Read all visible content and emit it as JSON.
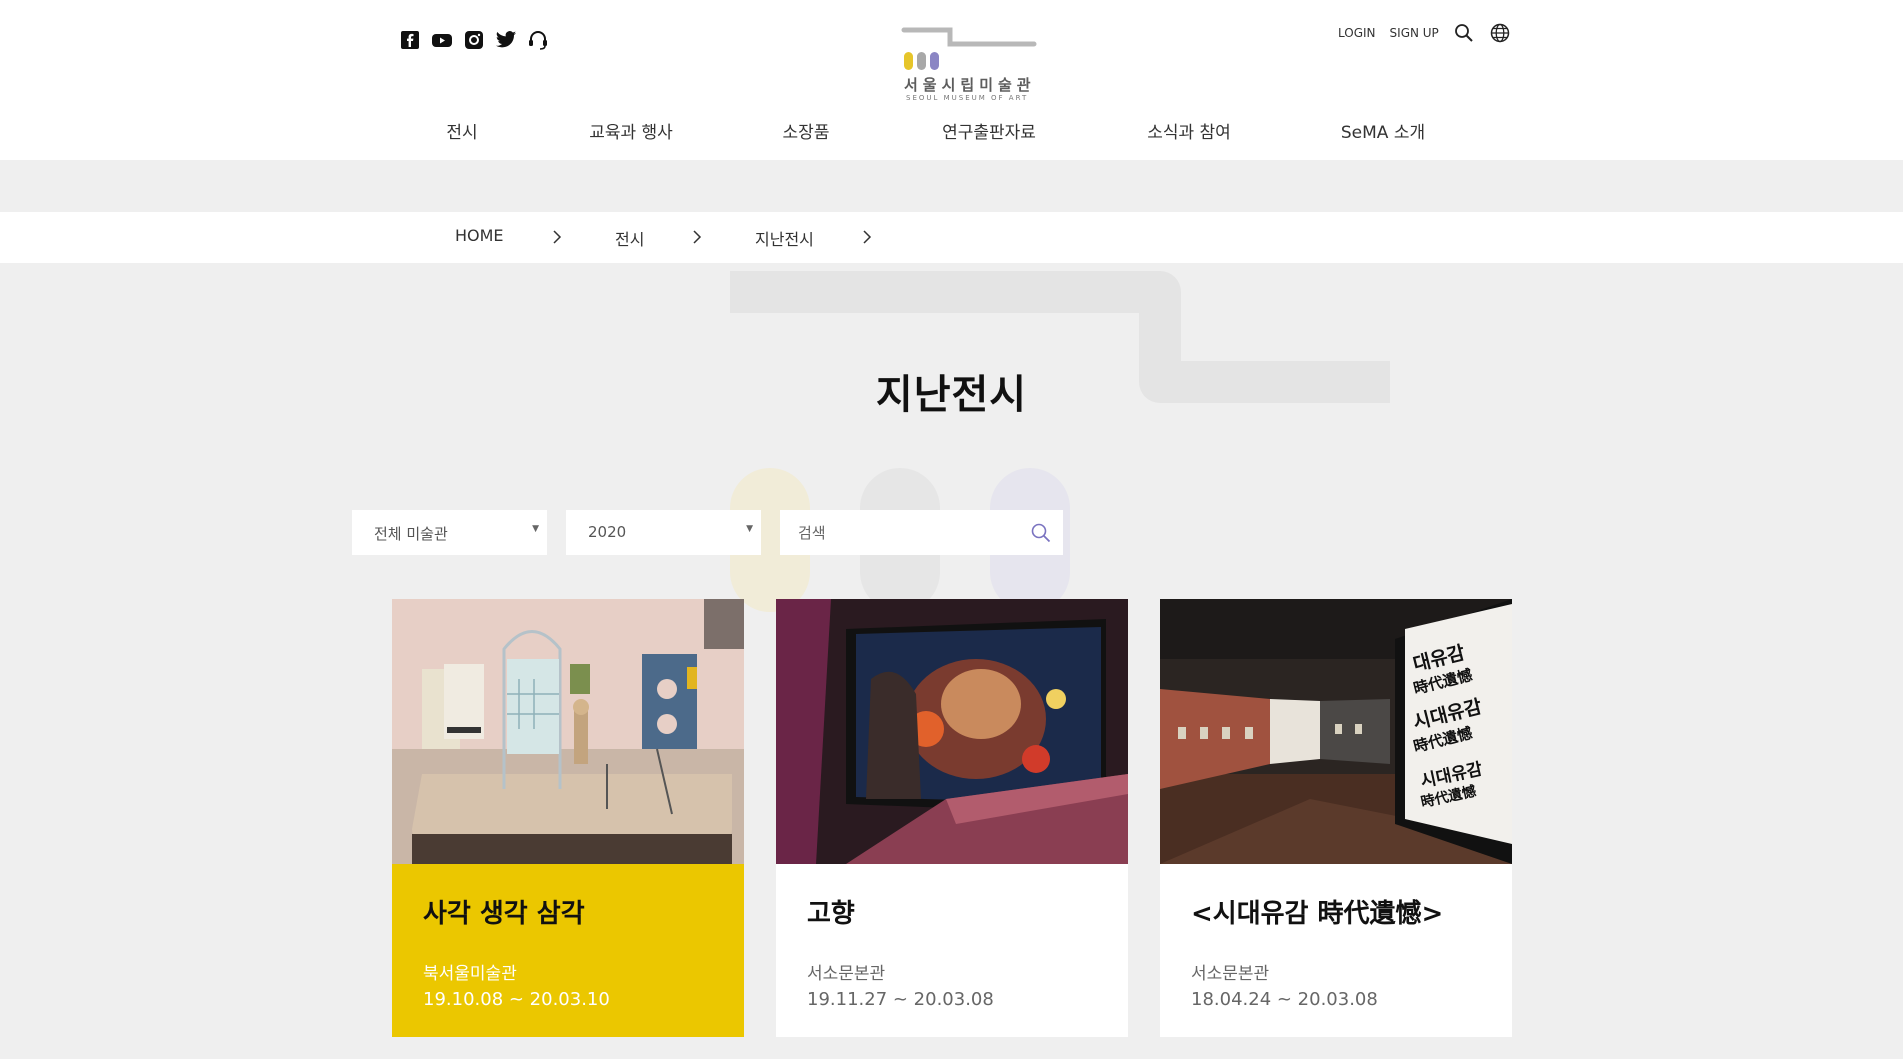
{
  "header": {
    "social_icons": [
      "facebook-icon",
      "youtube-icon",
      "instagram-icon",
      "twitter-icon",
      "headset-icon"
    ],
    "logo": {
      "ko": "서울시립미술관",
      "en": "SEOUL MUSEUM OF ART",
      "colors": [
        "#e6c52a",
        "#a8a8a8",
        "#8b86c4"
      ]
    },
    "util": {
      "login": "LOGIN",
      "signup": "SIGN UP",
      "icons": [
        "search-icon",
        "globe-icon"
      ]
    }
  },
  "gnb": {
    "items": [
      "전시",
      "교육과 행사",
      "소장품",
      "연구출판자료",
      "소식과 참여",
      "SeMA 소개"
    ]
  },
  "breadcrumb": {
    "items": [
      "HOME",
      "전시",
      "지난전시"
    ]
  },
  "main": {
    "title": "지난전시"
  },
  "filters": {
    "museum": "전체 미술관",
    "year": "2020",
    "search_placeholder": "검색"
  },
  "cards": [
    {
      "title": "사각 생각 삼각",
      "venue": "북서울미술관",
      "date": "19.10.08 ~ 20.03.10",
      "highlight": "#ebc700"
    },
    {
      "title": "고향",
      "venue": "서소문본관",
      "date": "19.11.27 ~ 20.03.08"
    },
    {
      "title": "<시대유감 時代遺憾>",
      "venue": "서소문본관",
      "date": "18.04.24 ~ 20.03.08",
      "poster_text": [
        "대유감",
        "時代遺憾",
        "시대유감",
        "時代遺憾",
        "시대유감",
        "時代遺憾"
      ]
    }
  ]
}
